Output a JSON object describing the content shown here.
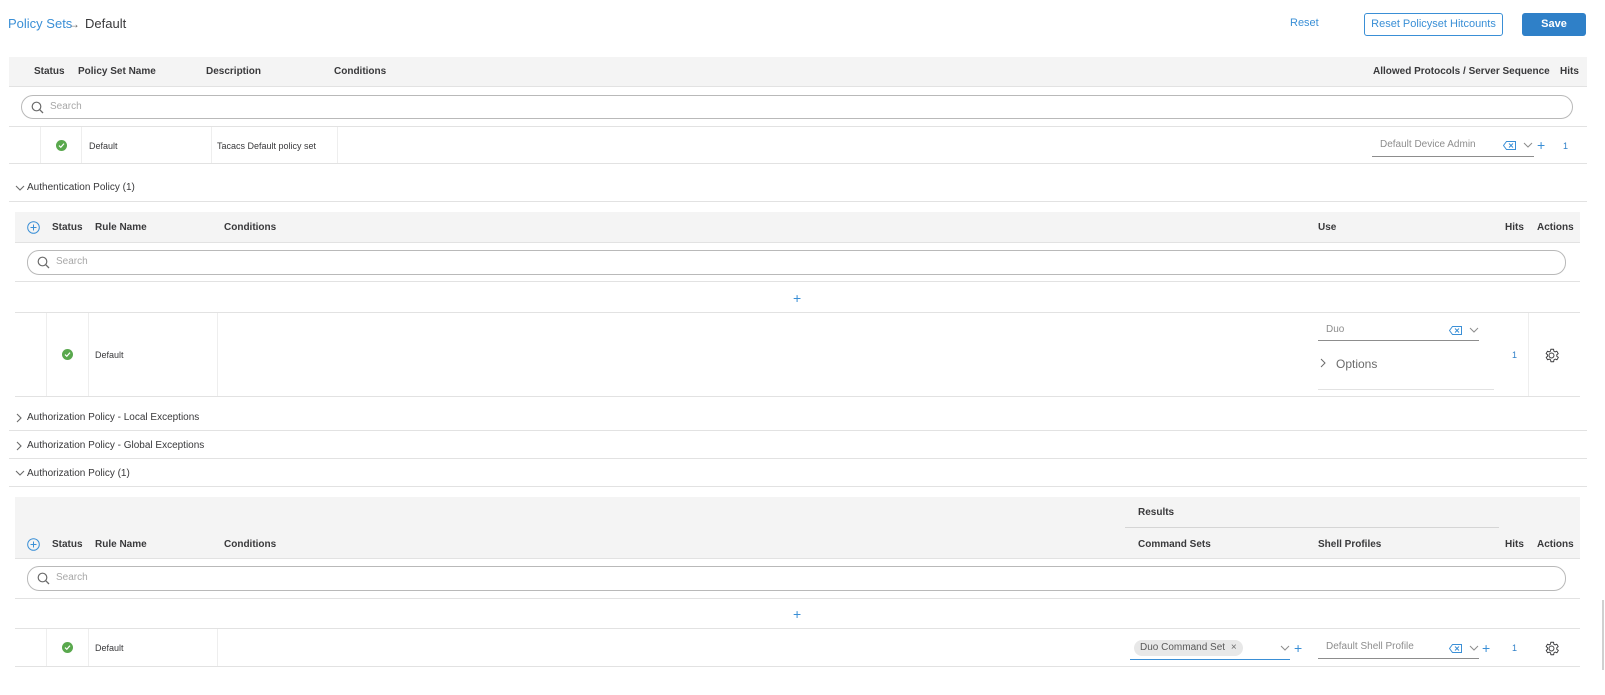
{
  "header": {
    "breadcrumb_link": "Policy Sets",
    "breadcrumb_arrow": "→",
    "breadcrumb_current": "Default",
    "reset_label": "Reset",
    "reset_hitcounts_label": "Reset Policyset Hitcounts",
    "save_label": "Save"
  },
  "policy_sets": {
    "columns": {
      "status": "Status",
      "name": "Policy Set Name",
      "description": "Description",
      "conditions": "Conditions",
      "protocols": "Allowed Protocols / Server Sequence",
      "hits": "Hits"
    },
    "search_placeholder": "Search",
    "row": {
      "name": "Default",
      "description": "Tacacs Default policy set",
      "protocol": "Default Device Admin",
      "hits": "1"
    }
  },
  "authentication": {
    "title": "Authentication Policy (1)",
    "columns": {
      "status": "Status",
      "rule_name": "Rule Name",
      "conditions": "Conditions",
      "use": "Use",
      "hits": "Hits",
      "actions": "Actions"
    },
    "search_placeholder": "Search",
    "add_symbol": "+",
    "row": {
      "name": "Default",
      "use_value": "Duo",
      "options_label": "Options",
      "hits": "1"
    }
  },
  "collapsed_sections": [
    {
      "title": "Authorization Policy - Local Exceptions"
    },
    {
      "title": "Authorization Policy - Global Exceptions"
    }
  ],
  "authorization": {
    "title": "Authorization Policy (1)",
    "results_label": "Results",
    "columns": {
      "status": "Status",
      "rule_name": "Rule Name",
      "conditions": "Conditions",
      "command_sets": "Command Sets",
      "shell_profiles": "Shell Profiles",
      "hits": "Hits",
      "actions": "Actions"
    },
    "search_placeholder": "Search",
    "add_symbol": "+",
    "row": {
      "name": "Default",
      "command_set_chip": "Duo Command Set",
      "shell_profile": "Default Shell Profile",
      "hits": "1"
    }
  },
  "colors": {
    "accent": "#3a8fd6",
    "primary_button": "#2f80c8",
    "status_ok": "#59a84d",
    "header_band": "#f4f4f4"
  }
}
